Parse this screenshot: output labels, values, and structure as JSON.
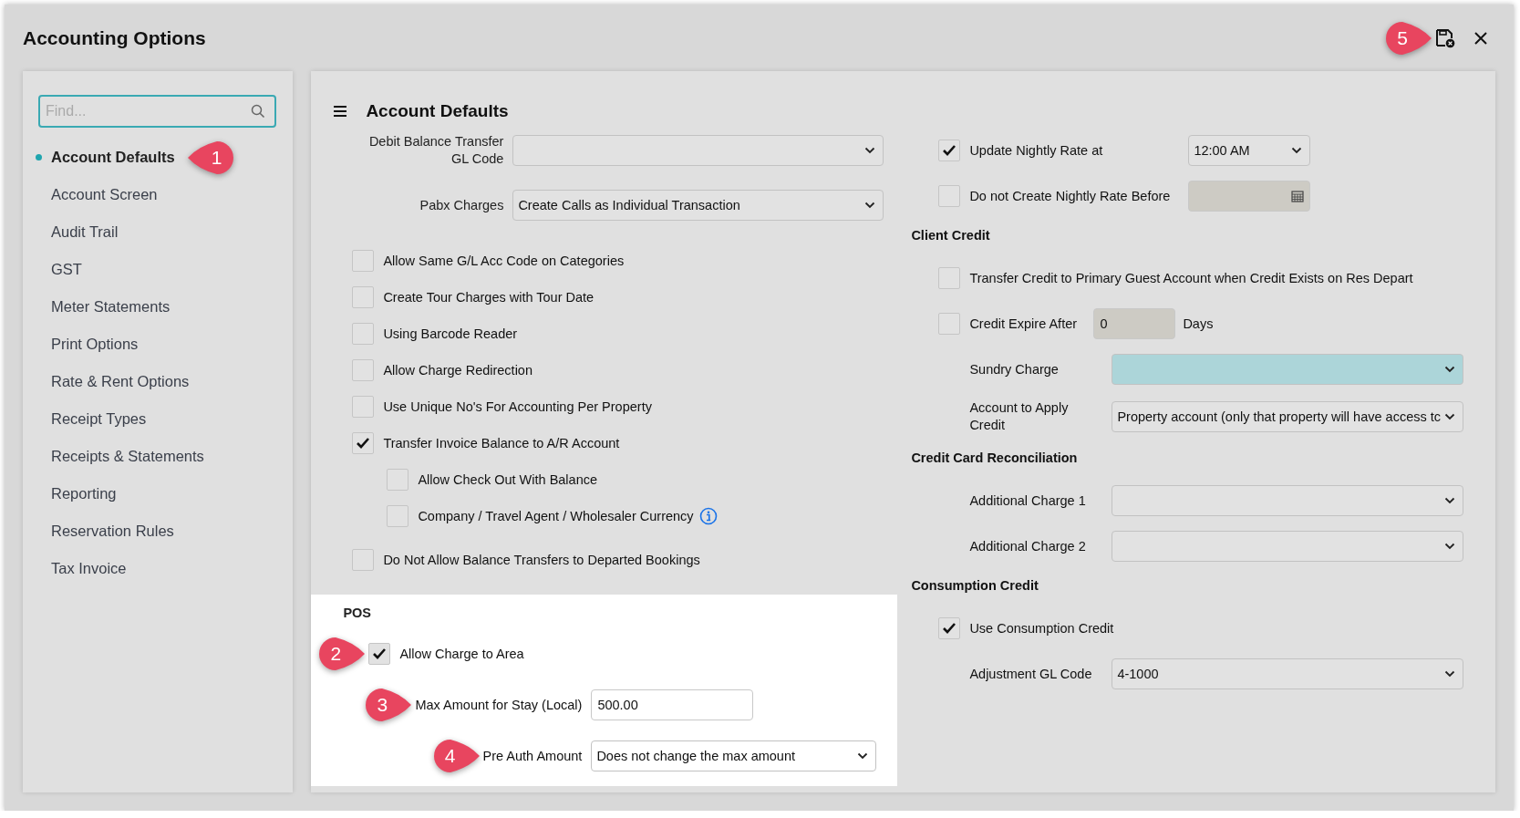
{
  "window": {
    "title": "Accounting Options",
    "callout": {
      "label": "5"
    }
  },
  "sidebar": {
    "search": {
      "placeholder": "Find..."
    },
    "items": [
      {
        "label": "Account Defaults",
        "selected": true,
        "callout": {
          "label": "1"
        }
      },
      {
        "label": "Account Screen",
        "selected": false
      },
      {
        "label": "Audit Trail",
        "selected": false
      },
      {
        "label": "GST",
        "selected": false
      },
      {
        "label": "Meter Statements",
        "selected": false
      },
      {
        "label": "Print Options",
        "selected": false
      },
      {
        "label": "Rate & Rent Options",
        "selected": false
      },
      {
        "label": "Receipt Types",
        "selected": false
      },
      {
        "label": "Receipts & Statements",
        "selected": false
      },
      {
        "label": "Reporting",
        "selected": false
      },
      {
        "label": "Reservation Rules",
        "selected": false
      },
      {
        "label": "Tax Invoice",
        "selected": false
      }
    ]
  },
  "section": {
    "title": "Account Defaults"
  },
  "left": {
    "rows": [
      {
        "kind": "select",
        "label": "Debit Balance Transfer GL Code",
        "value": ""
      },
      {
        "kind": "select",
        "label": "Pabx Charges",
        "value": "Create Calls as Individual Transaction"
      },
      {
        "kind": "checkbox",
        "label": "Allow Same G/L Acc Code on Categories",
        "checked": false
      },
      {
        "kind": "checkbox",
        "label": "Create Tour Charges with Tour Date",
        "checked": false
      },
      {
        "kind": "checkbox",
        "label": "Using Barcode Reader",
        "checked": false
      },
      {
        "kind": "checkbox",
        "label": "Allow Charge Redirection",
        "checked": false
      },
      {
        "kind": "checkbox",
        "label": "Use Unique No's For Accounting Per Property",
        "checked": false
      },
      {
        "kind": "checkbox",
        "label": "Transfer Invoice Balance to A/R Account",
        "checked": true,
        "children": [
          {
            "kind": "checkbox",
            "label": "Allow Check Out With Balance",
            "checked": false
          },
          {
            "kind": "checkbox",
            "label": "Company / Travel Agent / Wholesaler Currency",
            "checked": false,
            "info": true
          }
        ]
      },
      {
        "kind": "checkbox",
        "label": "Do Not Allow Balance Transfers to Departed Bookings",
        "checked": false
      }
    ]
  },
  "pos": {
    "title": "POS",
    "rows": [
      {
        "kind": "checkbox",
        "label": "Allow Charge to Area",
        "checked": true,
        "callout": {
          "label": "2"
        }
      },
      {
        "kind": "input",
        "label": "Max Amount for Stay (Local)",
        "value": "500.00",
        "callout": {
          "label": "3"
        }
      },
      {
        "kind": "select",
        "label": "Pre Auth Amount",
        "value": "Does not change the max amount",
        "callout": {
          "label": "4"
        }
      }
    ]
  },
  "right": {
    "groups": [
      {
        "rows": [
          {
            "kind": "checkbox-select",
            "label": "Update Nightly Rate at",
            "checked": true,
            "value": "12:00 AM"
          },
          {
            "kind": "checkbox-date",
            "label": "Do not Create Nightly Rate Before",
            "checked": false,
            "disabled": true
          }
        ]
      },
      {
        "title": "Client Credit",
        "rows": [
          {
            "kind": "checkbox",
            "label": "Transfer Credit to Primary Guest Account when Credit Exists on Res Depart",
            "checked": false
          },
          {
            "kind": "checkbox-input",
            "label": "Credit Expire After",
            "checked": false,
            "value": "0",
            "unit": "Days",
            "disabled": true
          },
          {
            "kind": "select",
            "label": "Sundry Charge",
            "value": "",
            "highlighted": true
          },
          {
            "kind": "select",
            "label": "Account to Apply Credit",
            "value": "Property account (only that property will have access tc",
            "highlighted": false
          }
        ]
      },
      {
        "title": "Credit Card Reconciliation",
        "rows": [
          {
            "kind": "select",
            "label": "Additional Charge 1",
            "value": "",
            "highlighted": false
          },
          {
            "kind": "select",
            "label": "Additional Charge 2",
            "value": "",
            "highlighted": false
          }
        ]
      },
      {
        "title": "Consumption Credit",
        "rows": [
          {
            "kind": "checkbox",
            "label": "Use Consumption Credit",
            "checked": true
          },
          {
            "kind": "select",
            "label": "Adjustment GL Code",
            "value": "4-1000",
            "highlighted": false
          }
        ]
      }
    ]
  }
}
